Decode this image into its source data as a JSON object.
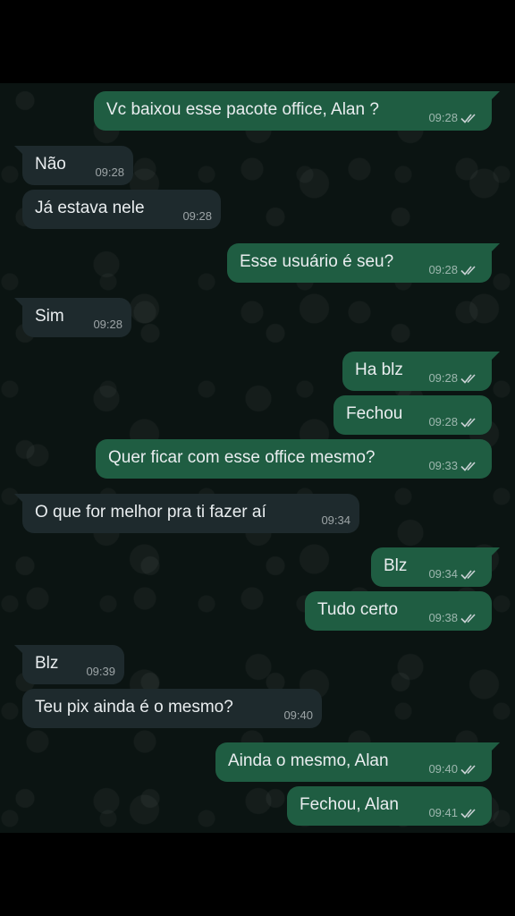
{
  "colors": {
    "outgoing_bubble": "#1f5d42",
    "incoming_bubble": "#1e2a2d",
    "chat_background": "#0b1412",
    "check_color": "#c9d1d4"
  },
  "icons": {
    "read_receipt": "double-check-icon"
  },
  "messages": [
    {
      "dir": "out",
      "tail": true,
      "text": "Vc baixou esse pacote office, Alan ?",
      "time": "09:28"
    },
    {
      "dir": "in",
      "tail": true,
      "text": "Não",
      "time": "09:28"
    },
    {
      "dir": "in",
      "tail": false,
      "text": "Já estava nele",
      "time": "09:28"
    },
    {
      "dir": "out",
      "tail": true,
      "text": "Esse usuário é seu?",
      "time": "09:28"
    },
    {
      "dir": "in",
      "tail": true,
      "text": "Sim",
      "time": "09:28"
    },
    {
      "dir": "out",
      "tail": true,
      "text": "Ha blz",
      "time": "09:28"
    },
    {
      "dir": "out",
      "tail": false,
      "text": "Fechou",
      "time": "09:28"
    },
    {
      "dir": "out",
      "tail": false,
      "text": "Quer ficar com esse office mesmo?",
      "time": "09:33"
    },
    {
      "dir": "in",
      "tail": true,
      "text": "O que for melhor pra ti fazer aí",
      "time": "09:34"
    },
    {
      "dir": "out",
      "tail": true,
      "text": "Blz",
      "time": "09:34"
    },
    {
      "dir": "out",
      "tail": false,
      "text": "Tudo certo",
      "time": "09:38"
    },
    {
      "dir": "in",
      "tail": true,
      "text": "Blz",
      "time": "09:39"
    },
    {
      "dir": "in",
      "tail": false,
      "text": "Teu pix ainda é o mesmo?",
      "time": "09:40"
    },
    {
      "dir": "out",
      "tail": true,
      "text": "Ainda o mesmo, Alan",
      "time": "09:40"
    },
    {
      "dir": "out",
      "tail": false,
      "text": "Fechou, Alan",
      "time": "09:41"
    }
  ]
}
